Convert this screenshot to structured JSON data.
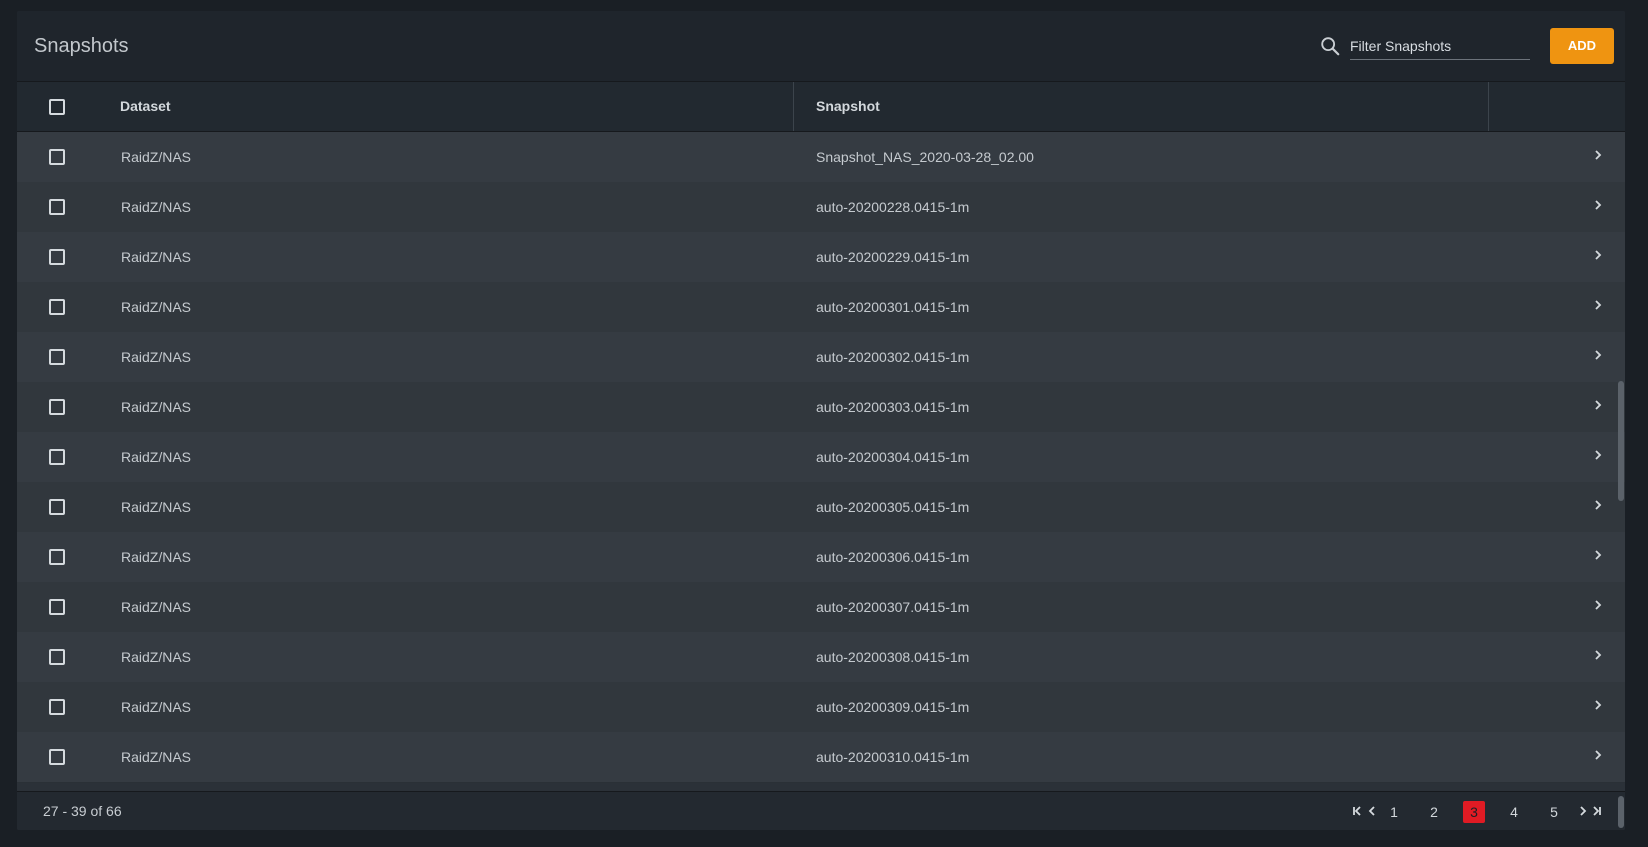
{
  "header": {
    "title": "Snapshots",
    "filter_placeholder": "Filter Snapshots",
    "add_label": "ADD"
  },
  "table": {
    "columns": [
      "Dataset",
      "Snapshot"
    ],
    "rows": [
      {
        "dataset": "RaidZ/NAS",
        "snapshot": "Snapshot_NAS_2020-03-28_02.00"
      },
      {
        "dataset": "RaidZ/NAS",
        "snapshot": "auto-20200228.0415-1m"
      },
      {
        "dataset": "RaidZ/NAS",
        "snapshot": "auto-20200229.0415-1m"
      },
      {
        "dataset": "RaidZ/NAS",
        "snapshot": "auto-20200301.0415-1m"
      },
      {
        "dataset": "RaidZ/NAS",
        "snapshot": "auto-20200302.0415-1m"
      },
      {
        "dataset": "RaidZ/NAS",
        "snapshot": "auto-20200303.0415-1m"
      },
      {
        "dataset": "RaidZ/NAS",
        "snapshot": "auto-20200304.0415-1m"
      },
      {
        "dataset": "RaidZ/NAS",
        "snapshot": "auto-20200305.0415-1m"
      },
      {
        "dataset": "RaidZ/NAS",
        "snapshot": "auto-20200306.0415-1m"
      },
      {
        "dataset": "RaidZ/NAS",
        "snapshot": "auto-20200307.0415-1m"
      },
      {
        "dataset": "RaidZ/NAS",
        "snapshot": "auto-20200308.0415-1m"
      },
      {
        "dataset": "RaidZ/NAS",
        "snapshot": "auto-20200309.0415-1m"
      },
      {
        "dataset": "RaidZ/NAS",
        "snapshot": "auto-20200310.0415-1m"
      }
    ]
  },
  "footer": {
    "range_label": "27 - 39 of 66",
    "pages": [
      "1",
      "2",
      "3",
      "4",
      "5"
    ],
    "current_page": "3"
  },
  "colors": {
    "accent": "#ef9411",
    "active_page": "#e01b24"
  },
  "icons": {
    "search": "search-icon",
    "row_expand": "chevron-right-icon",
    "first_page": "first-page-icon",
    "prev_page": "chevron-left-icon",
    "next_page": "chevron-right-icon",
    "last_page": "last-page-icon"
  }
}
